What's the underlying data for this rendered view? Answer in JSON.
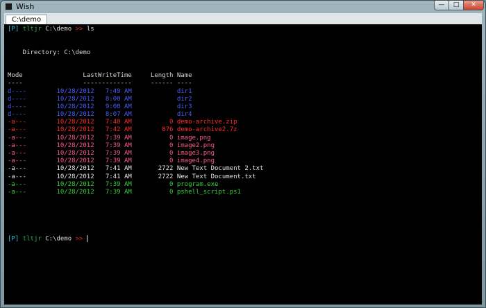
{
  "window": {
    "title": "Wish",
    "tab_label": "C:\\demo"
  },
  "colors": {
    "bracket": "#2ec4d6",
    "user": "#3aa85a",
    "arrows": "#e0302c",
    "dir": "#4b5bff",
    "archive": "#ff2a2a",
    "image": "#ff5a8a",
    "text": "#e6e6e6",
    "exe": "#3ad13a"
  },
  "prompt": {
    "bracket": "[P]",
    "user": "tltjr",
    "path": "C:\\demo",
    "arrows": ">>",
    "command": "ls"
  },
  "listing": {
    "directory_line": "    Directory: C:\\demo",
    "header": "Mode                LastWriteTime     Length Name",
    "underline": "----                -------------     ------ ----",
    "rows": [
      {
        "text": "d----        10/28/2012   7:49 AM            dir1",
        "kind": "dir"
      },
      {
        "text": "d----        10/28/2012   8:00 AM            dir2",
        "kind": "dir"
      },
      {
        "text": "d----        10/28/2012   9:00 AM            dir3",
        "kind": "dir"
      },
      {
        "text": "d----        10/28/2012   8:07 AM            dir4",
        "kind": "dir"
      },
      {
        "text": "-a---        10/28/2012   7:40 AM          0 demo-archive.zip",
        "kind": "archive"
      },
      {
        "text": "-a---        10/28/2012   7:42 AM        876 demo-archive2.7z",
        "kind": "archive"
      },
      {
        "text": "-a---        10/28/2012   7:39 AM          0 image.png",
        "kind": "image"
      },
      {
        "text": "-a---        10/28/2012   7:39 AM          0 image2.png",
        "kind": "image"
      },
      {
        "text": "-a---        10/28/2012   7:39 AM          0 image3.png",
        "kind": "image"
      },
      {
        "text": "-a---        10/28/2012   7:39 AM          0 image4.png",
        "kind": "image"
      },
      {
        "text": "-a---        10/28/2012   7:41 AM       2722 New Text Document 2.txt",
        "kind": "text"
      },
      {
        "text": "-a---        10/28/2012   7:41 AM       2722 New Text Document.txt",
        "kind": "text"
      },
      {
        "text": "-a---        10/28/2012   7:39 AM          0 program.exe",
        "kind": "exe"
      },
      {
        "text": "-a---        10/28/2012   7:39 AM          0 pshell_script.ps1",
        "kind": "exe"
      }
    ]
  }
}
